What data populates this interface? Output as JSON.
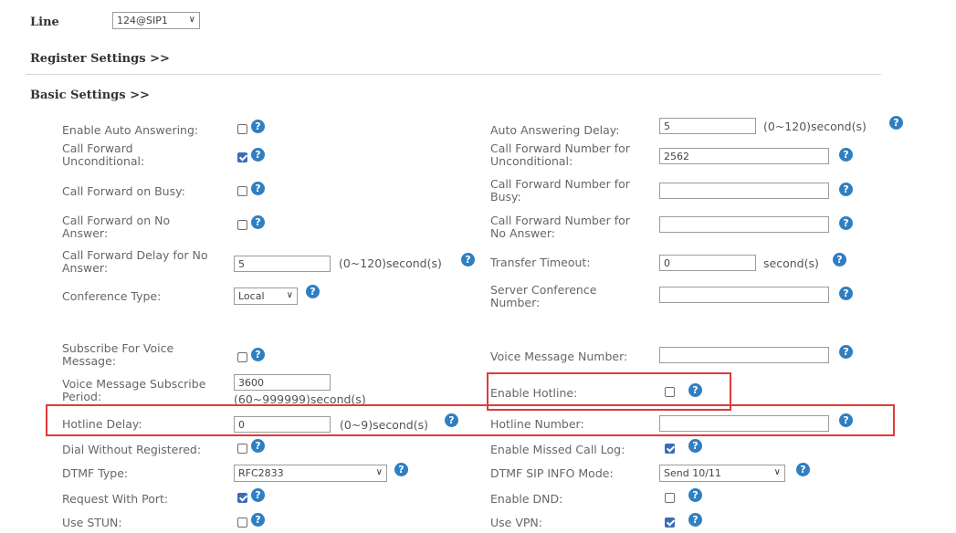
{
  "line": {
    "label": "Line",
    "value": "124@SIP1"
  },
  "register_settings": "Register Settings >>",
  "basic_settings": "Basic Settings >>",
  "help_glyph": "?",
  "chevron": "∨",
  "left": {
    "auto_answering": {
      "label": "Enable Auto Answering:",
      "checked": false
    },
    "cfu": {
      "label1": "Call Forward",
      "label2": "Unconditional:",
      "checked": true
    },
    "cfb": {
      "label": "Call Forward on Busy:",
      "checked": false
    },
    "cfna": {
      "label1": "Call Forward on No",
      "label2": "Answer:",
      "checked": false
    },
    "cf_delay": {
      "label1": "Call Forward Delay for No",
      "label2": "Answer:",
      "value": "5",
      "unit": "(0~120)second(s)"
    },
    "conf_type": {
      "label": "Conference Type:",
      "value": "Local"
    },
    "subscribe_vm": {
      "label1": "Subscribe For Voice",
      "label2": "Message:",
      "checked": false
    },
    "vm_period": {
      "label1": "Voice Message Subscribe",
      "label2": "Period:",
      "value": "3600",
      "unit": "(60~999999)second(s)"
    },
    "hotline_delay": {
      "label": "Hotline Delay:",
      "value": "0",
      "unit": "(0~9)second(s)"
    },
    "dial_without_reg": {
      "label": "Dial Without Registered:",
      "checked": false
    },
    "dtmf_type": {
      "label": "DTMF Type:",
      "value": "RFC2833"
    },
    "request_port": {
      "label": "Request With Port:",
      "checked": true
    },
    "use_stun": {
      "label": "Use STUN:",
      "checked": false
    }
  },
  "right": {
    "aa_delay": {
      "label": "Auto Answering Delay:",
      "value": "5",
      "unit": "(0~120)second(s)"
    },
    "cfu_num": {
      "label1": "Call Forward Number for",
      "label2": "Unconditional:",
      "value": "2562"
    },
    "cfb_num": {
      "label1": "Call Forward Number for",
      "label2": "Busy:",
      "value": ""
    },
    "cfna_num": {
      "label1": "Call Forward Number for",
      "label2": "No Answer:",
      "value": ""
    },
    "transfer_timeout": {
      "label": "Transfer Timeout:",
      "value": "0",
      "unit": "second(s)"
    },
    "server_conf": {
      "label1": "Server Conference",
      "label2": "Number:",
      "value": ""
    },
    "vm_number": {
      "label": "Voice Message Number:",
      "value": ""
    },
    "enable_hotline": {
      "label": "Enable Hotline:",
      "checked": false
    },
    "hotline_number": {
      "label": "Hotline Number:",
      "value": ""
    },
    "missed_call_log": {
      "label": "Enable Missed Call Log:",
      "checked": true
    },
    "dtmf_sip_info": {
      "label": "DTMF SIP INFO Mode:",
      "value": "Send 10/11"
    },
    "dnd": {
      "label": "Enable DND:",
      "checked": false
    },
    "use_vpn": {
      "label": "Use VPN:",
      "checked": true
    }
  },
  "highlight_color": "#e03a3a",
  "accent_color": "#2f7fc1"
}
